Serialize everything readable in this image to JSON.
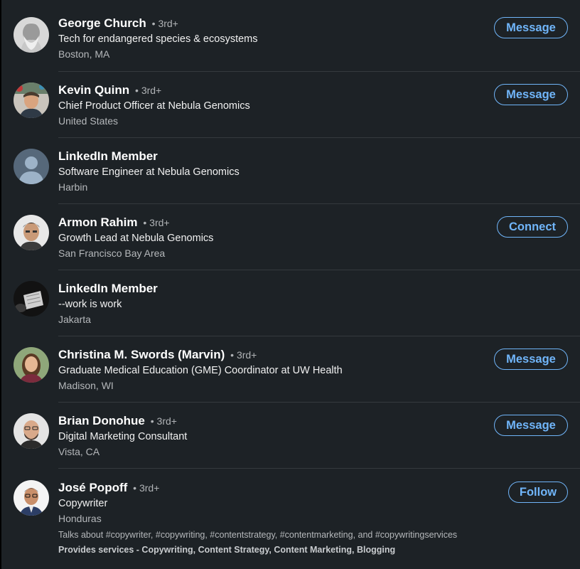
{
  "people": [
    {
      "name": "George Church",
      "degree": "3rd+",
      "headline": "Tech for endangered species & ecosystems",
      "location": "Boston, MA",
      "action": "Message",
      "avatar": "portrait-photo"
    },
    {
      "name": "Kevin Quinn",
      "degree": "3rd+",
      "headline": "Chief Product Officer at Nebula Genomics",
      "location": "United States",
      "action": "Message",
      "avatar": "portrait-photo"
    },
    {
      "name": "LinkedIn Member",
      "headline": "Software Engineer at Nebula Genomics",
      "location": "Harbin",
      "avatar": "ghost-avatar"
    },
    {
      "name": "Armon Rahim",
      "degree": "3rd+",
      "headline": "Growth Lead at Nebula Genomics",
      "location": "San Francisco Bay Area",
      "action": "Connect",
      "avatar": "portrait-photo"
    },
    {
      "name": "LinkedIn Member",
      "headline": "--work is work",
      "location": "Jakarta",
      "avatar": "photo"
    },
    {
      "name": "Christina M. Swords (Marvin)",
      "degree": "3rd+",
      "headline": "Graduate Medical Education (GME) Coordinator at UW Health",
      "location": "Madison, WI",
      "action": "Message",
      "avatar": "portrait-photo"
    },
    {
      "name": "Brian Donohue",
      "degree": "3rd+",
      "headline": "Digital Marketing Consultant",
      "location": "Vista, CA",
      "action": "Message",
      "avatar": "portrait-photo"
    },
    {
      "name": "José Popoff",
      "degree": "3rd+",
      "headline": "Copywriter",
      "location": "Honduras",
      "action": "Follow",
      "avatar": "portrait-photo",
      "talks_about": "Talks about #copywriter, #copywriting, #contentstrategy, #contentmarketing, and #copywritingservices",
      "provides_services": "Provides services - Copywriting, Content Strategy, Content Marketing, Blogging"
    }
  ],
  "colors": {
    "background": "#1d2226",
    "accent": "#70b5f9",
    "text_primary": "#ffffff",
    "text_secondary": "#b5b8bb"
  }
}
